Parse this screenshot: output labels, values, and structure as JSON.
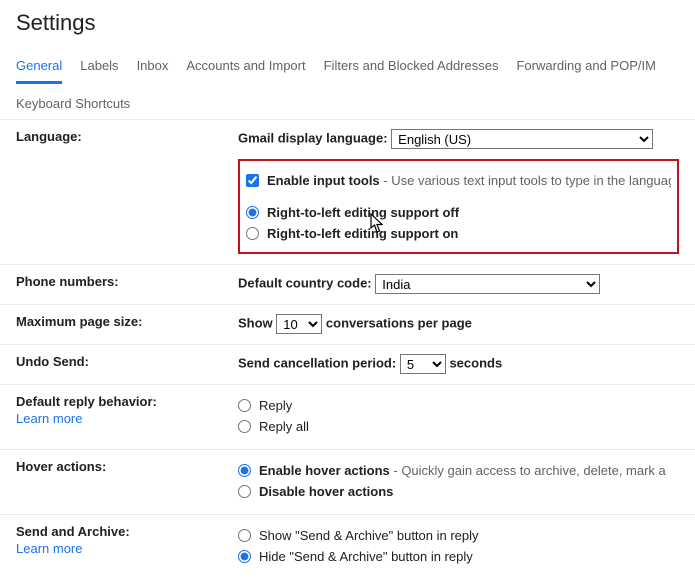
{
  "page_title": "Settings",
  "tabs": [
    "General",
    "Labels",
    "Inbox",
    "Accounts and Import",
    "Filters and Blocked Addresses",
    "Forwarding and POP/IM"
  ],
  "active_tab_index": 0,
  "subtab": "Keyboard Shortcuts",
  "language": {
    "label": "Language:",
    "display_label": "Gmail display language:",
    "selected": "English (US)",
    "enable_input_tools_label": "Enable input tools",
    "enable_input_tools_desc": " - Use various text input tools to type in the languag",
    "enable_input_tools_checked": true,
    "rtl_off_label": "Right-to-left editing support off",
    "rtl_on_label": "Right-to-left editing support on",
    "rtl_selected": "off"
  },
  "phone": {
    "label": "Phone numbers:",
    "code_label": "Default country code:",
    "selected": "India"
  },
  "page_size": {
    "label": "Maximum page size:",
    "prefix": "Show",
    "selected": "10",
    "suffix": "conversations per page"
  },
  "undo_send": {
    "label": "Undo Send:",
    "prefix": "Send cancellation period:",
    "selected": "5",
    "suffix": "seconds"
  },
  "reply": {
    "label": "Default reply behavior:",
    "learn_more": "Learn more",
    "option_reply": "Reply",
    "option_reply_all": "Reply all",
    "selected": ""
  },
  "hover": {
    "label": "Hover actions:",
    "enable_label": "Enable hover actions",
    "enable_desc": " - Quickly gain access to archive, delete, mark a",
    "disable_label": "Disable hover actions",
    "selected": "enable"
  },
  "send_archive": {
    "label": "Send and Archive:",
    "learn_more": "Learn more",
    "show_label": "Show \"Send & Archive\" button in reply",
    "hide_label": "Hide \"Send & Archive\" button in reply",
    "selected": "hide"
  }
}
